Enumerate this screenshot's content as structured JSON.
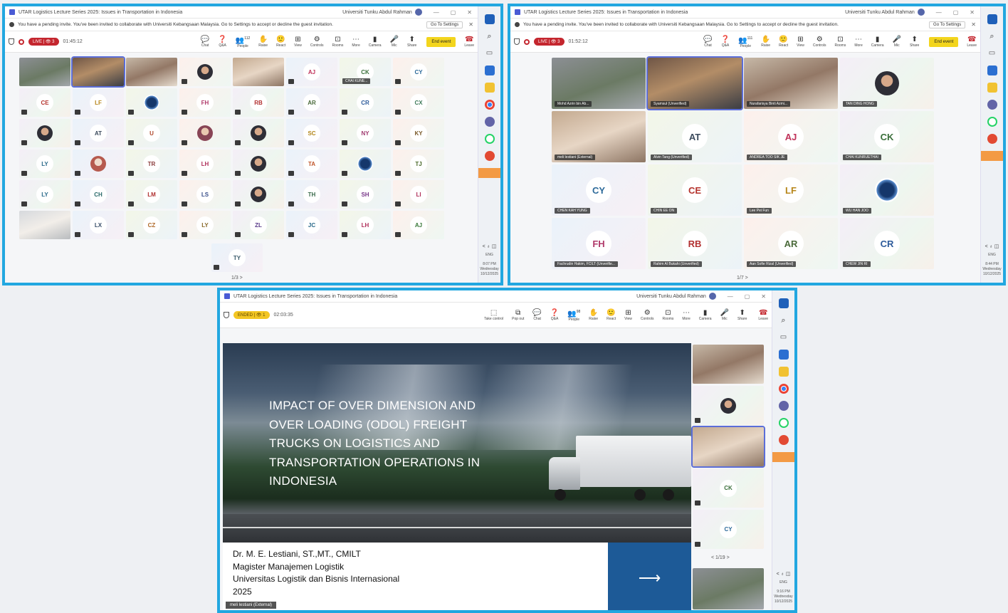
{
  "window": {
    "title": "UTAR Logistics Lecture Series 2025: Issues in Transportation in Indonesia",
    "org": "Universiti Tunku Abdul Rahman",
    "minimize": "—",
    "restore": "▢",
    "close": "✕"
  },
  "notice": {
    "text": "You have a pending invite. You've been invited to collaborate with Universiti Kebangsaan Malaysia. Go to Settings to accept or decline the guest invitation.",
    "button": "Go To Settings",
    "close": "✕"
  },
  "toolbar": {
    "tools": [
      {
        "icon": "💬",
        "label": "Chat"
      },
      {
        "icon": "❓",
        "label": "Q&A"
      },
      {
        "icon": "👥",
        "label": "People"
      },
      {
        "icon": "✋",
        "label": "Raise"
      },
      {
        "icon": "🙂",
        "label": "React"
      },
      {
        "icon": "⊞",
        "label": "View"
      },
      {
        "icon": "⚙",
        "label": "Controls"
      },
      {
        "icon": "⊡",
        "label": "Rooms"
      },
      {
        "icon": "⋯",
        "label": "More"
      },
      {
        "icon": "▮",
        "label": "Camera"
      },
      {
        "icon": "🎤",
        "label": "Mic"
      },
      {
        "icon": "⬆",
        "label": "Share"
      }
    ],
    "end_event": "End event",
    "leave": "Leave",
    "leave_icon": "☎"
  },
  "shot1": {
    "status": "LIVE | 👁 3",
    "timer": "01:45:12",
    "people_count": "112",
    "pager": "1/3  >",
    "tiles": [
      {
        "t": "cam",
        "v": "c1"
      },
      {
        "t": "cam",
        "v": "c2",
        "sel": true
      },
      {
        "t": "cam",
        "v": "c3"
      },
      {
        "t": "photo",
        "v": "p1"
      },
      {
        "t": "cam",
        "v": "c5"
      },
      {
        "t": "ini",
        "v": "AJ",
        "c": "#c0335a"
      },
      {
        "t": "ini",
        "v": "CK",
        "c": "#3a6f3a",
        "name": "CHAI KUNE..."
      },
      {
        "t": "ini",
        "v": "CY",
        "c": "#2d6a9a"
      },
      {
        "t": "ini",
        "v": "CE",
        "c": "#b5332d"
      },
      {
        "t": "ini",
        "v": "LF",
        "c": "#b7861a"
      },
      {
        "t": "photo",
        "v": "p3"
      },
      {
        "t": "ini",
        "v": "FH",
        "c": "#b03a6a"
      },
      {
        "t": "ini",
        "v": "RB",
        "c": "#b23030"
      },
      {
        "t": "ini",
        "v": "AR",
        "c": "#4a6a3a"
      },
      {
        "t": "ini",
        "v": "CR",
        "c": "#2c5a9a"
      },
      {
        "t": "ini",
        "v": "CX",
        "c": "#3f7a5a"
      },
      {
        "t": "photo",
        "v": "p1"
      },
      {
        "t": "ini",
        "v": "AT",
        "c": "#3b4a5c"
      },
      {
        "t": "ini",
        "v": "U",
        "c": "#b0472a"
      },
      {
        "t": "photo",
        "v": "p2"
      },
      {
        "t": "photo",
        "v": "p1"
      },
      {
        "t": "ini",
        "v": "SC",
        "c": "#b2861a"
      },
      {
        "t": "ini",
        "v": "NY",
        "c": "#a03a70"
      },
      {
        "t": "ini",
        "v": "KY",
        "c": "#7a5a2a"
      },
      {
        "t": "ini",
        "v": "LY",
        "c": "#2a6a8a"
      },
      {
        "t": "photo",
        "v": "p4"
      },
      {
        "t": "ini",
        "v": "TR",
        "c": "#8a3a3a"
      },
      {
        "t": "ini",
        "v": "LH",
        "c": "#b0305a"
      },
      {
        "t": "photo",
        "v": "p1"
      },
      {
        "t": "ini",
        "v": "TA",
        "c": "#c0562a"
      },
      {
        "t": "photo",
        "v": "p3"
      },
      {
        "t": "ini",
        "v": "TJ",
        "c": "#4a6a2a"
      },
      {
        "t": "ini",
        "v": "LY",
        "c": "#2a6a8a"
      },
      {
        "t": "ini",
        "v": "CH",
        "c": "#2a6a6a"
      },
      {
        "t": "ini",
        "v": "LM",
        "c": "#b03030"
      },
      {
        "t": "ini",
        "v": "LS",
        "c": "#3a4f8a"
      },
      {
        "t": "photo",
        "v": "p1"
      },
      {
        "t": "ini",
        "v": "TH",
        "c": "#3a6a4a"
      },
      {
        "t": "ini",
        "v": "SH",
        "c": "#7a3a8a"
      },
      {
        "t": "ini",
        "v": "LI",
        "c": "#b0305a"
      },
      {
        "t": "cam",
        "v": "c4"
      },
      {
        "t": "ini",
        "v": "LX",
        "c": "#3a4f6a"
      },
      {
        "t": "ini",
        "v": "CZ",
        "c": "#b06a2a"
      },
      {
        "t": "ini",
        "v": "LY",
        "c": "#8a6a2a"
      },
      {
        "t": "ini",
        "v": "ZL",
        "c": "#5a3a8a"
      },
      {
        "t": "ini",
        "v": "JC",
        "c": "#2a6a8a"
      },
      {
        "t": "ini",
        "v": "LH",
        "c": "#b0305a"
      },
      {
        "t": "ini",
        "v": "AJ",
        "c": "#3a7a3a"
      }
    ],
    "last_tile": {
      "t": "ini",
      "v": "TY",
      "c": "#3a5a6a"
    }
  },
  "shot2": {
    "status": "LIVE | 👁 3",
    "timer": "01:52:12",
    "people_count": "111",
    "pager": "1/7  >",
    "tiles": [
      {
        "t": "cam",
        "v": "c1",
        "name": "Mohd Azrin bin Ab..."
      },
      {
        "t": "cam",
        "v": "c2",
        "name": "Syamsul (Unverified)",
        "sel": true
      },
      {
        "t": "cam",
        "v": "c3",
        "name": "Nurafarisya Binti Azmi..."
      },
      {
        "t": "photo",
        "v": "p1",
        "name": "TAN DING HONG"
      },
      {
        "t": "cam",
        "v": "c5",
        "name": "meli lestiani (External)"
      },
      {
        "t": "ini",
        "v": "AT",
        "c": "#3b4a5c",
        "name": "Alvin Tang (Unverified)"
      },
      {
        "t": "ini",
        "v": "AJ",
        "c": "#c0335a",
        "name": "ANDREA TOO SIK JE"
      },
      {
        "t": "ini",
        "v": "CK",
        "c": "#3a6f3a",
        "name": "CHAI KUNRUETHAI"
      },
      {
        "t": "ini",
        "v": "CY",
        "c": "#2d6a9a",
        "name": "CHEN KAH YUNG"
      },
      {
        "t": "ini",
        "v": "CE",
        "c": "#b5332d",
        "name": "CHIN EE ON"
      },
      {
        "t": "ini",
        "v": "LF",
        "c": "#b7861a",
        "name": "Lee Pei Fun"
      },
      {
        "t": "photo",
        "v": "p3",
        "name": "WU HAN JOO"
      },
      {
        "t": "ini",
        "v": "FH",
        "c": "#b03a6a",
        "name": "Fachrudin Hakim, FCILT (Unverifie..."
      },
      {
        "t": "ini",
        "v": "RB",
        "c": "#b23030",
        "name": "Rahim Al Bukahi (Unverified)"
      },
      {
        "t": "ini",
        "v": "AR",
        "c": "#4a6a3a",
        "name": "Aan Sofie Rizal (Unverified)"
      },
      {
        "t": "ini",
        "v": "CR",
        "c": "#2c5a9a",
        "name": "CHEW JIN RI"
      }
    ]
  },
  "shot3": {
    "status": "ENDED | 👁 1",
    "timer": "02:03:35",
    "people_count": "98",
    "extra_tools": [
      {
        "icon": "⬚",
        "label": "Take control"
      },
      {
        "icon": "⧉",
        "label": "Pop out"
      }
    ],
    "slide": {
      "title": "IMPACT OF OVER DIMENSION AND OVER LOADING (ODOL) FREIGHT TRUCKS ON LOGISTICS AND TRANSPORTATION OPERATIONS IN INDONESIA",
      "author_lines": [
        "Dr. M. E. Lestiani, ST.,MT., CMILT",
        "Magister Manajemen Logistik",
        "Universitas Logistik dan Bisnis Internasional",
        "2025"
      ],
      "arrow": "⟶"
    },
    "rail": [
      {
        "t": "cam",
        "v": "c3"
      },
      {
        "t": "photo",
        "v": "p1"
      },
      {
        "t": "cam",
        "v": "c5",
        "sel": true
      },
      {
        "t": "ini",
        "v": "CK",
        "c": "#3a6f3a"
      },
      {
        "t": "ini",
        "v": "CY",
        "c": "#2d6a9a"
      }
    ],
    "pager": "<   1/19   >",
    "self_name": "meli lestiani (External)"
  },
  "taskbar": {
    "lang": "ENG",
    "clock1": [
      "8:07 PM",
      "Wednesday",
      "10/12/2025"
    ],
    "clock2": [
      "8:44 PM",
      "Wednesday",
      "10/12/2025"
    ],
    "clock3": [
      "9:16 PM",
      "Wednesday",
      "10/12/2025"
    ],
    "systray": "< ♁ ◫"
  }
}
